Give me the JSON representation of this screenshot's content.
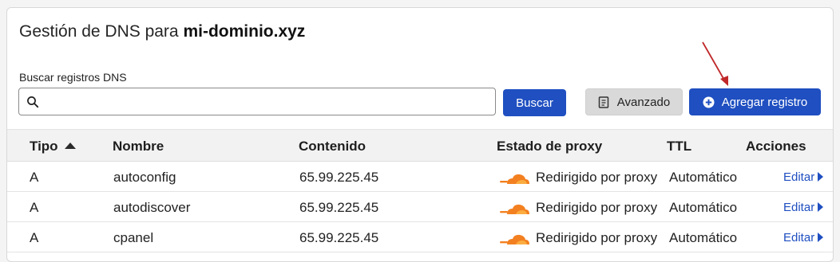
{
  "header": {
    "title_prefix": "Gestión de DNS para",
    "domain": "mi-dominio.xyz"
  },
  "search": {
    "label": "Buscar registros DNS",
    "value": "",
    "placeholder": "",
    "button_label": "Buscar"
  },
  "toolbar": {
    "advanced_label": "Avanzado",
    "add_label": "Agregar registro"
  },
  "colors": {
    "primary": "#1f4fc1",
    "proxy_cloud": "#f38020",
    "annotation_arrow": "#c0282a"
  },
  "table": {
    "columns": [
      "Tipo",
      "Nombre",
      "Contenido",
      "Estado de proxy",
      "TTL",
      "Acciones"
    ],
    "sort_column": "Tipo",
    "sort_direction": "ascending",
    "rows": [
      {
        "type": "A",
        "name": "autoconfig",
        "content": "65.99.225.45",
        "proxy_status": "Redirigido por proxy",
        "ttl": "Automático",
        "action": "Editar"
      },
      {
        "type": "A",
        "name": "autodiscover",
        "content": "65.99.225.45",
        "proxy_status": "Redirigido por proxy",
        "ttl": "Automático",
        "action": "Editar"
      },
      {
        "type": "A",
        "name": "cpanel",
        "content": "65.99.225.45",
        "proxy_status": "Redirigido por proxy",
        "ttl": "Automático",
        "action": "Editar"
      }
    ]
  }
}
